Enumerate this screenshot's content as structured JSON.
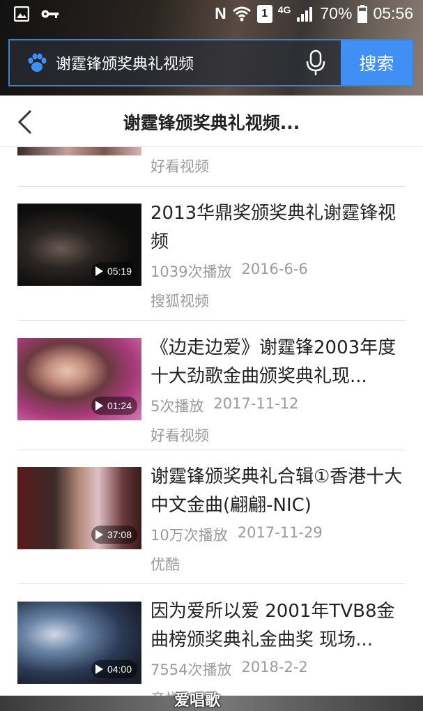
{
  "status_bar": {
    "network_letter": "N",
    "sim_label": "1",
    "network_type": "4G",
    "battery": "70%",
    "time": "05:56"
  },
  "search": {
    "query": "谢霆锋颁奖典礼视频",
    "button_label": "搜索"
  },
  "nav": {
    "title": "谢霆锋颁奖典礼视频..."
  },
  "partial_item": {
    "source": "好看视频"
  },
  "videos": [
    {
      "title": "2013华鼎奖颁奖典礼谢霆锋视频",
      "duration": "05:19",
      "plays": "1039次播放",
      "date": "2016-6-6",
      "source": "搜狐视频"
    },
    {
      "title": "《边走边爱》谢霆锋2003年度十大劲歌金曲颁奖典礼现...",
      "duration": "01:24",
      "plays": "5次播放",
      "date": "2017-11-12",
      "source": "好看视频"
    },
    {
      "title": "谢霆锋颁奖典礼合辑①香港十大中文金曲(翩翩-NIC)",
      "duration": "37:08",
      "plays": "10万次播放",
      "date": "2017-11-29",
      "source": "优酷"
    },
    {
      "title": "因为爱所以爱 2001年TVB8金曲榜颁奖典礼金曲奖 现场...",
      "duration": "04:00",
      "plays": "7554次播放",
      "date": "2018-2-2",
      "source": "音悦Tai"
    }
  ],
  "watermark": "爱唱歌",
  "colors": {
    "accent": "#3f8ff5",
    "meta_text": "#9a9a9a"
  }
}
